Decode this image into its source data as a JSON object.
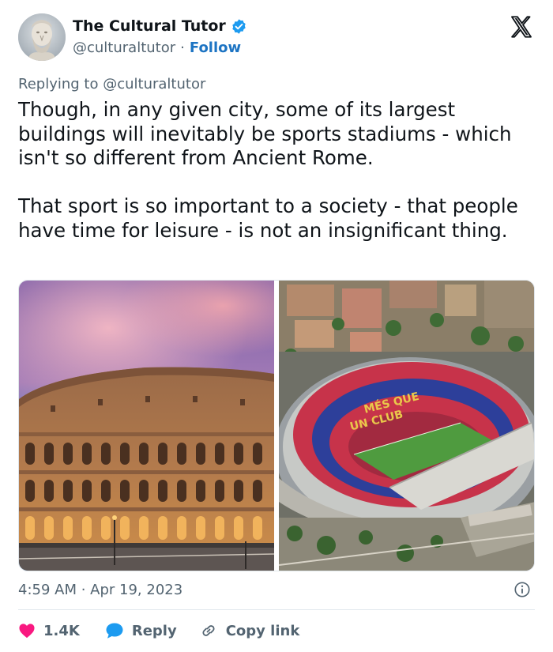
{
  "author": {
    "name": "The Cultural Tutor",
    "handle": "@culturaltutor",
    "separator": "·",
    "follow_label": "Follow"
  },
  "reply_context": {
    "prefix": "Replying to",
    "mention": "@culturaltutor"
  },
  "tweet": {
    "paragraph1": "Though, in any given city, some of its largest buildings will inevitably be sports stadiums - which isn't so different from Ancient Rome.",
    "paragraph2": "That sport is so important to a society - that people have time for leisure - is not an insignificant thing."
  },
  "media": {
    "left": "colosseum-photo",
    "right": "stadium-aerial-photo",
    "stadium_seat_text_line1": "MÉS QUE",
    "stadium_seat_text_line2": "UN CLUB"
  },
  "meta": {
    "timestamp": "4:59 AM · Apr 19, 2023"
  },
  "actions": {
    "likes": "1.4K",
    "reply_label": "Reply",
    "copy_label": "Copy link"
  },
  "colors": {
    "accent": "#1d9bf0",
    "follow": "#1d74c3",
    "heart": "#f91880",
    "secondary_text": "#536471",
    "primary_text": "#0f1419"
  },
  "icons": {
    "verified": "verified-badge-icon",
    "brand": "x-logo-icon",
    "info": "info-icon",
    "like": "heart-icon",
    "reply": "speech-bubble-icon",
    "copy": "link-icon"
  }
}
